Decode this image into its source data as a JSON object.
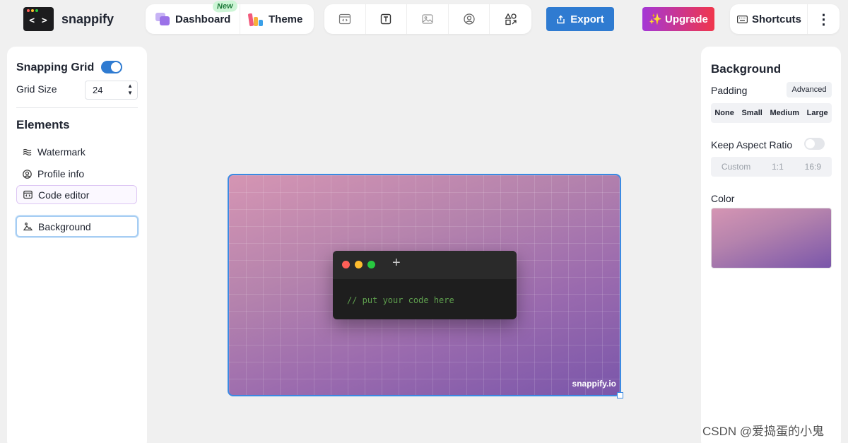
{
  "app": {
    "name": "snappify",
    "logo_glyph": "< >"
  },
  "nav": {
    "dashboard_label": "Dashboard",
    "new_badge": "New",
    "theme_label": "Theme"
  },
  "toolbar": {
    "tools": [
      "code-window-icon",
      "text-box-icon",
      "image-icon",
      "profile-icon",
      "shapes-icon"
    ]
  },
  "actions": {
    "export_label": "Export",
    "upgrade_label": "✨ Upgrade",
    "shortcuts_label": "Shortcuts",
    "more_glyph": "⋮"
  },
  "left_panel": {
    "snapping_grid_label": "Snapping Grid",
    "snapping_grid_on": true,
    "grid_size_label": "Grid Size",
    "grid_size_value": "24",
    "elements_title": "Elements",
    "elements": [
      {
        "label": "Watermark",
        "icon": "watermark-icon"
      },
      {
        "label": "Profile info",
        "icon": "profile-icon"
      },
      {
        "label": "Code editor",
        "icon": "code-window-icon"
      },
      {
        "label": "Background",
        "icon": "background-icon"
      }
    ]
  },
  "canvas": {
    "code_placeholder": "// put your code here",
    "watermark_text": "snappify.io",
    "gradient": [
      "#d595b3",
      "#7a56aa"
    ]
  },
  "right_panel": {
    "title": "Background",
    "padding_label": "Padding",
    "advanced_label": "Advanced",
    "padding_options": [
      "None",
      "Small",
      "Medium",
      "Large"
    ],
    "aspect_label": "Keep Aspect Ratio",
    "aspect_on": false,
    "aspect_options": [
      "Custom",
      "1:1",
      "16:9"
    ],
    "color_label": "Color"
  },
  "colors": {
    "accent": "#2f7bd1",
    "upgrade_start": "#a437d6",
    "upgrade_end": "#f0364c"
  },
  "credit": "CSDN @爱捣蛋的小鬼"
}
